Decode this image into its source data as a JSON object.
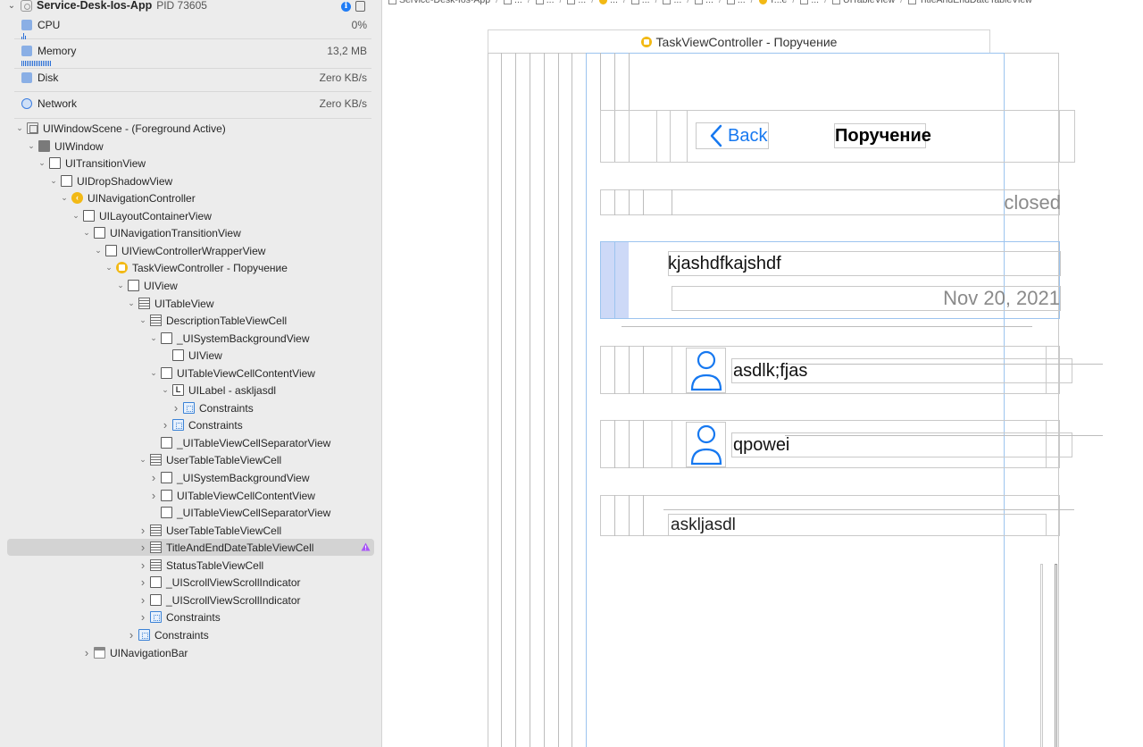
{
  "process": {
    "name": "Service-Desk-Ios-App",
    "pid": "PID 73605"
  },
  "gauges": [
    {
      "label": "CPU",
      "value": "0%",
      "icon": "cpu-icon",
      "color": "#3b7de0"
    },
    {
      "label": "Memory",
      "value": "13,2 MB",
      "icon": "memory-icon",
      "color": "#3b7de0"
    },
    {
      "label": "Disk",
      "value": "Zero KB/s",
      "icon": "disk-icon",
      "color": "#3b7de0"
    },
    {
      "label": "Network",
      "value": "Zero KB/s",
      "icon": "network-icon",
      "color": "#3b7de0"
    }
  ],
  "tree": [
    {
      "label": "UIWindowScene - (Foreground Active)",
      "level": 0,
      "expanded": true,
      "icon": "scene"
    },
    {
      "label": "UIWindow",
      "level": 1,
      "expanded": true,
      "icon": "window"
    },
    {
      "label": "UITransitionView",
      "level": 2,
      "expanded": true,
      "icon": "view"
    },
    {
      "label": "UIDropShadowView",
      "level": 3,
      "expanded": true,
      "icon": "view"
    },
    {
      "label": "UINavigationController",
      "level": 4,
      "expanded": true,
      "icon": "navctl"
    },
    {
      "label": "UILayoutContainerView",
      "level": 5,
      "expanded": true,
      "icon": "view"
    },
    {
      "label": "UINavigationTransitionView",
      "level": 6,
      "expanded": true,
      "icon": "view"
    },
    {
      "label": "UIViewControllerWrapperView",
      "level": 7,
      "expanded": true,
      "icon": "view"
    },
    {
      "label": "TaskViewController - Поручение",
      "level": 8,
      "expanded": true,
      "icon": "vc"
    },
    {
      "label": "UIView",
      "level": 9,
      "expanded": true,
      "icon": "view"
    },
    {
      "label": "UITableView",
      "level": 10,
      "expanded": true,
      "icon": "table"
    },
    {
      "label": "DescriptionTableViewCell",
      "level": 11,
      "expanded": true,
      "icon": "table"
    },
    {
      "label": "_UISystemBackgroundView",
      "level": 12,
      "expanded": true,
      "icon": "view"
    },
    {
      "label": "UIView",
      "level": 13,
      "expanded": null,
      "icon": "view"
    },
    {
      "label": "UITableViewCellContentView",
      "level": 12,
      "expanded": true,
      "icon": "view"
    },
    {
      "label": "UILabel - askljasdl",
      "level": 13,
      "expanded": true,
      "icon": "label"
    },
    {
      "label": "Constraints",
      "level": 14,
      "expanded": false,
      "icon": "constraint"
    },
    {
      "label": "Constraints",
      "level": 13,
      "expanded": false,
      "icon": "constraint"
    },
    {
      "label": "_UITableViewCellSeparatorView",
      "level": 12,
      "expanded": null,
      "icon": "view"
    },
    {
      "label": "UserTableTableViewCell",
      "level": 11,
      "expanded": true,
      "icon": "table"
    },
    {
      "label": "_UISystemBackgroundView",
      "level": 12,
      "expanded": false,
      "icon": "view"
    },
    {
      "label": "UITableViewCellContentView",
      "level": 12,
      "expanded": false,
      "icon": "view"
    },
    {
      "label": "_UITableViewCellSeparatorView",
      "level": 12,
      "expanded": null,
      "icon": "view"
    },
    {
      "label": "UserTableTableViewCell",
      "level": 11,
      "expanded": false,
      "icon": "table"
    },
    {
      "label": "TitleAndEndDateTableViewCell",
      "level": 11,
      "expanded": false,
      "icon": "table",
      "selected": true,
      "warning": true
    },
    {
      "label": "StatusTableViewCell",
      "level": 11,
      "expanded": false,
      "icon": "table"
    },
    {
      "label": "_UIScrollViewScrollIndicator",
      "level": 11,
      "expanded": false,
      "icon": "view"
    },
    {
      "label": "_UIScrollViewScrollIndicator",
      "level": 11,
      "expanded": false,
      "icon": "view"
    },
    {
      "label": "Constraints",
      "level": 11,
      "expanded": false,
      "icon": "constraint"
    },
    {
      "label": "Constraints",
      "level": 10,
      "expanded": false,
      "icon": "constraint"
    },
    {
      "label": "UINavigationBar",
      "level": 6,
      "expanded": false,
      "icon": "navbar"
    }
  ],
  "jumpbar": [
    "Service-Desk-Ios-App",
    "...",
    "...",
    "...",
    "...",
    "...",
    "...",
    "...",
    "...",
    "T...e",
    "...",
    "UITableView",
    "TitleAndEndDateTableView"
  ],
  "canvas": {
    "vc_title": "TaskViewController - Поручение",
    "back_label": "Back",
    "nav_title": "Поручение",
    "status": "closed",
    "task_title": "kjashdfkajshdf",
    "task_date": "Nov 20, 2021",
    "users": [
      "asdlk;fjas",
      "qpowei"
    ],
    "description": "askljasdl"
  }
}
